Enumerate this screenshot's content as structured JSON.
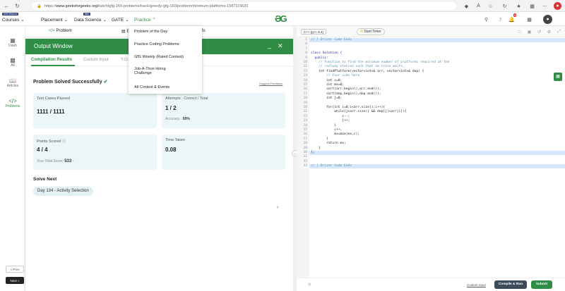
{
  "browser": {
    "url_prefix": "https://",
    "url_host": "www.geeksforgeeks.org",
    "url_path": "/batch/gfg-160-problems/track/greedy-gfg-160/problem/minimum-platforms-1587115620"
  },
  "site": {
    "logo": "GG",
    "nav": [
      {
        "label": "Courses",
        "badge": "90% Refund"
      },
      {
        "label": "Placement"
      },
      {
        "label": "Data Science",
        "badge": "IBM"
      },
      {
        "label": "GATE"
      },
      {
        "label": "Practice"
      }
    ],
    "practice_menu": [
      "Problem of the Day",
      "Practice Coding Problems",
      "GfG Weekly (Rated Contest)",
      "Job-A-Thon Hiring Challenge",
      "All Contest & Events"
    ],
    "notification_count": "9"
  },
  "rail": {
    "items": [
      "Dash",
      "All",
      "Articles",
      "Problems"
    ],
    "prev_label": "« Prev",
    "next_label": "Next »"
  },
  "problem_tabs": {
    "problem": "Problem",
    "editorial": "Edit",
    "tail": "ts"
  },
  "output": {
    "title": "Output Window",
    "minimize": "_",
    "close": "✕",
    "tabs": [
      "Compilation Results",
      "Custom Input",
      "Y.O."
    ],
    "status": "Problem Solved Successfully",
    "feedback": "Suggest Feedback",
    "tests_label": "Test Cases Passed",
    "tests_value": "1111 / 1111",
    "attempts_label": "Attempts : Correct / Total",
    "attempts_value": "1 / 2",
    "accuracy_label": "Accuracy :",
    "accuracy_value": "50%",
    "points_label": "Points Scored",
    "points_value": "4 / 4",
    "total_label": "Your Total Score:",
    "total_value": "533",
    "time_label": "Time Taken",
    "time_value": "0.08",
    "solve_next": "Solve Next",
    "next_chip": "Day 134 - Activity Selection"
  },
  "editor": {
    "language": "C++ (g++ 5.4)",
    "timer": "Start Timer",
    "lines": [
      {
        "n": "1",
        "t": "// } Driver Code Ends",
        "hl": true,
        "type": "comment"
      },
      {
        "n": "6",
        "t": "",
        "type": ""
      },
      {
        "n": "7",
        "t": "",
        "type": ""
      },
      {
        "n": "8",
        "t": "class Solution {",
        "type": "kw"
      },
      {
        "n": "9",
        "t": "  public:",
        "type": "kw"
      },
      {
        "n": "10",
        "t": "    // Function to find the minimum number of platforms required at the",
        "type": "comment"
      },
      {
        "n": "11",
        "t": "    // railway station such that no train waits.",
        "type": "comment"
      },
      {
        "n": "12",
        "t": "    int findPlatform(vector<int>& arr, vector<int>& dep) {",
        "type": ""
      },
      {
        "n": "13",
        "t": "        // Your code here",
        "type": "comment"
      },
      {
        "n": "14",
        "t": "        int c=0;",
        "type": ""
      },
      {
        "n": "15",
        "t": "        int mx=0;",
        "type": ""
      },
      {
        "n": "16",
        "t": "        sort(arr.begin(),arr.end());",
        "type": ""
      },
      {
        "n": "17",
        "t": "        sort(dep.begin(),dep.end());",
        "type": ""
      },
      {
        "n": "18",
        "t": "        int j=0;",
        "type": ""
      },
      {
        "n": "19",
        "t": "",
        "type": ""
      },
      {
        "n": "20",
        "t": "        for(int i=0;i<arr.size();i++){",
        "type": ""
      },
      {
        "n": "21",
        "t": "            while(j<arr.size() && dep[j]<arr[i]){",
        "type": ""
      },
      {
        "n": "22",
        "t": "                c--;",
        "type": ""
      },
      {
        "n": "23",
        "t": "                j++;",
        "type": ""
      },
      {
        "n": "24",
        "t": "            }",
        "type": ""
      },
      {
        "n": "25",
        "t": "            c++;",
        "type": ""
      },
      {
        "n": "26",
        "t": "            mx=max(mx,c);",
        "type": ""
      },
      {
        "n": "27",
        "t": "        }",
        "type": ""
      },
      {
        "n": "28",
        "t": "        return mx;",
        "type": ""
      },
      {
        "n": "29",
        "t": "    }",
        "type": ""
      },
      {
        "n": "30",
        "t": "};",
        "hl": true,
        "type": ""
      },
      {
        "n": "31",
        "t": "",
        "type": ""
      },
      {
        "n": "32",
        "t": "",
        "type": ""
      },
      {
        "n": "33",
        "t": "// } Driver Code Ends",
        "hl": true,
        "type": "comment"
      }
    ],
    "custom_input": "Custom Input",
    "compile_label": "Compile & Run",
    "submit_label": "Submit"
  },
  "colors": {
    "brand": "#2f8d46",
    "card": "#eaf6f7",
    "highlight": "#d6e8fb"
  }
}
